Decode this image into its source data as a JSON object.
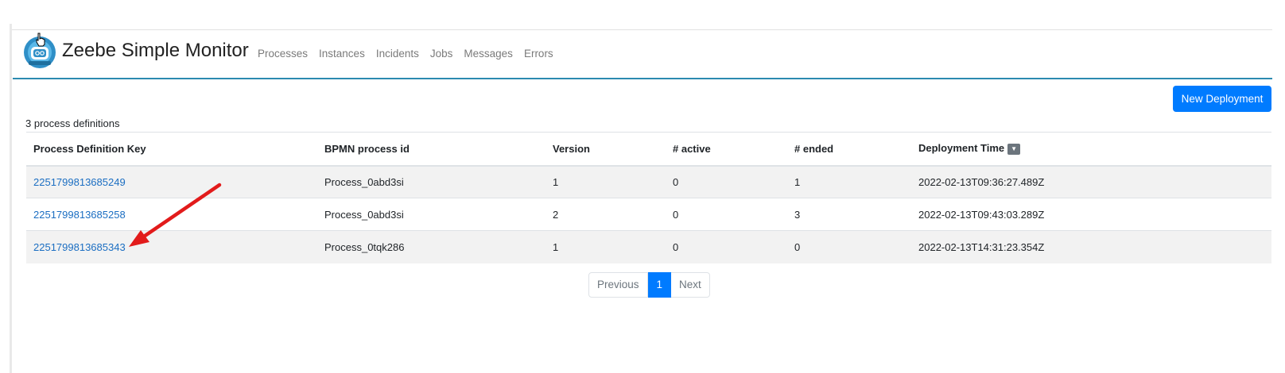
{
  "app": {
    "title": "Zeebe Simple Monitor"
  },
  "nav": {
    "links": [
      "Processes",
      "Instances",
      "Incidents",
      "Jobs",
      "Messages",
      "Errors"
    ]
  },
  "toolbar": {
    "new_deployment_label": "New Deployment"
  },
  "summary": {
    "count_text": "3 process definitions"
  },
  "table": {
    "headers": [
      "Process Definition Key",
      "BPMN process id",
      "Version",
      "# active",
      "# ended",
      "Deployment Time"
    ],
    "sort_icon": "caret-down-icon",
    "rows": [
      {
        "key": "2251799813685249",
        "bpmn_id": "Process_0abd3si",
        "version": "1",
        "active": "0",
        "ended": "1",
        "time": "2022-02-13T09:36:27.489Z"
      },
      {
        "key": "2251799813685258",
        "bpmn_id": "Process_0abd3si",
        "version": "2",
        "active": "0",
        "ended": "3",
        "time": "2022-02-13T09:43:03.289Z"
      },
      {
        "key": "2251799813685343",
        "bpmn_id": "Process_0tqk286",
        "version": "1",
        "active": "0",
        "ended": "0",
        "time": "2022-02-13T14:31:23.354Z"
      }
    ]
  },
  "pagination": {
    "previous_label": "Previous",
    "current_page": "1",
    "next_label": "Next"
  },
  "colors": {
    "accent": "#007bff",
    "link": "#1b6ec2",
    "nav_underline": "#2b8ab0",
    "arrow": "#e21b1b"
  }
}
